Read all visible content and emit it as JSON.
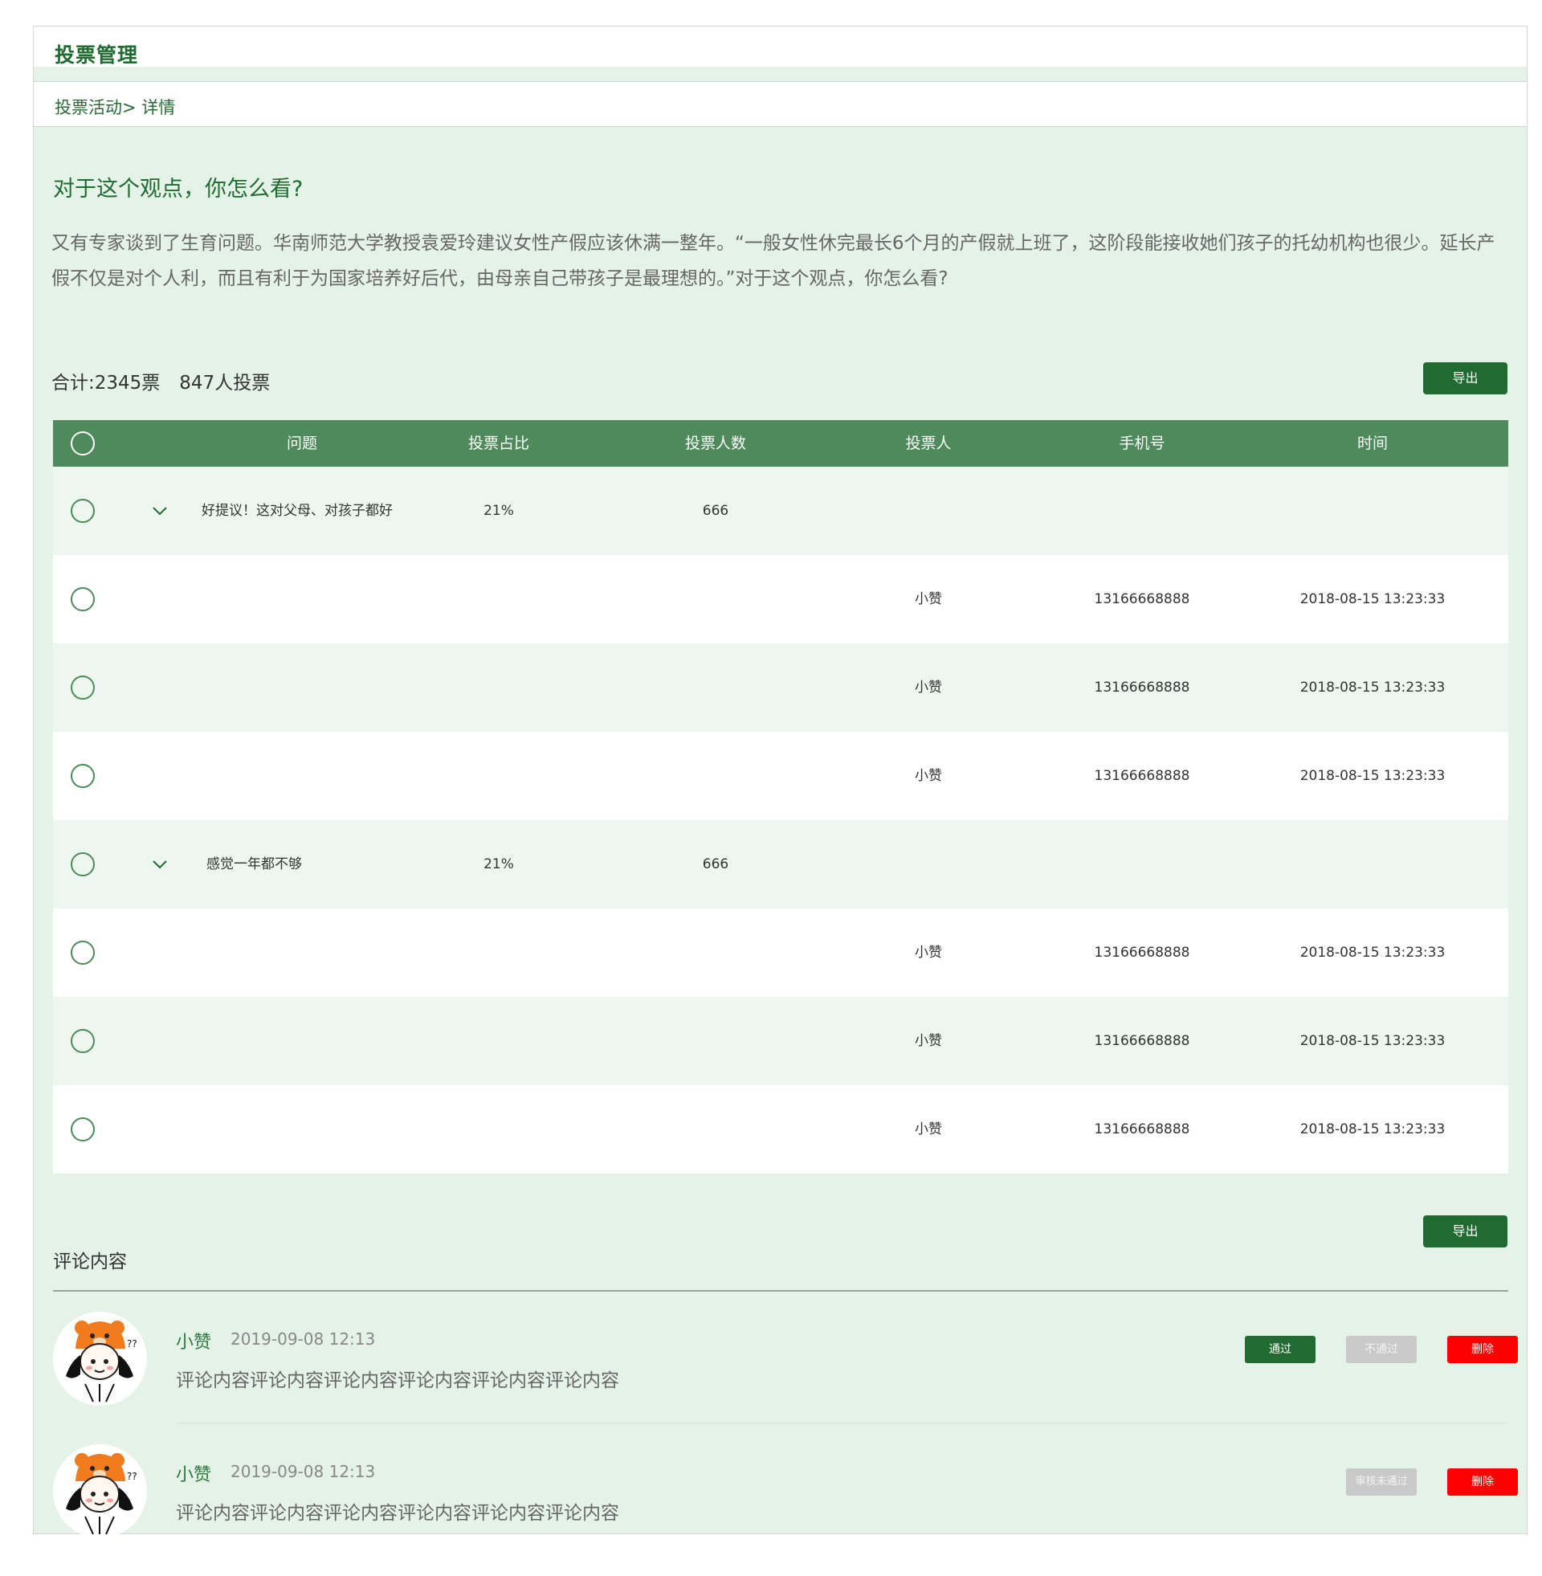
{
  "header": {
    "title": "投票管理"
  },
  "breadcrumb": "投票活动> 详情",
  "question": {
    "title": "对于这个观点，你怎么看?",
    "description": "又有专家谈到了生育问题。华南师范大学教授袁爱玲建议女性产假应该休满一整年。“一般女性休完最长6个月的产假就上班了，这阶段能接收她们孩子的托幼机构也很少。延长产假不仅是对个人利，而且有利于为国家培养好后代，由母亲自己带孩子是最理想的。”对于这个观点，你怎么看?"
  },
  "totals": {
    "votes": "合计:2345票",
    "people": "847人投票"
  },
  "export_label": "导出",
  "table": {
    "headers": {
      "question": "问题",
      "pct": "投票占比",
      "count": "投票人数",
      "voter": "投票人",
      "phone": "手机号",
      "time": "时间"
    },
    "rows": [
      {
        "type": "group",
        "question": "好提议！这对父母、对孩子都好",
        "pct": "21%",
        "count": "666"
      },
      {
        "type": "detail",
        "voter": "小赞",
        "phone": "13166668888",
        "time": "2018-08-15  13:23:33"
      },
      {
        "type": "detail",
        "voter": "小赞",
        "phone": "13166668888",
        "time": "2018-08-15  13:23:33"
      },
      {
        "type": "detail",
        "voter": "小赞",
        "phone": "13166668888",
        "time": "2018-08-15  13:23:33"
      },
      {
        "type": "group",
        "question": "感觉一年都不够",
        "pct": "21%",
        "count": "666"
      },
      {
        "type": "detail",
        "voter": "小赞",
        "phone": "13166668888",
        "time": "2018-08-15  13:23:33"
      },
      {
        "type": "detail",
        "voter": "小赞",
        "phone": "13166668888",
        "time": "2018-08-15  13:23:33"
      },
      {
        "type": "detail",
        "voter": "小赞",
        "phone": "13166668888",
        "time": "2018-08-15  13:23:33"
      }
    ]
  },
  "comments": {
    "heading": "评论内容",
    "items": [
      {
        "name": "小赞",
        "time": "2019-09-08 12:13",
        "text": "评论内容评论内容评论内容评论内容评论内容评论内容",
        "pass": "通过",
        "fail": "不通过",
        "delete": "删除"
      },
      {
        "name": "小赞",
        "time": "2019-09-08 12:13",
        "text": "评论内容评论内容评论内容评论内容评论内容评论内容",
        "fail": "审核未通过",
        "delete": "删除"
      }
    ]
  },
  "colors": {
    "brand": "#1f6b30",
    "header_row": "#4e8a5b",
    "page_bg": "#e5f2e8",
    "delete": "#ff0000"
  }
}
